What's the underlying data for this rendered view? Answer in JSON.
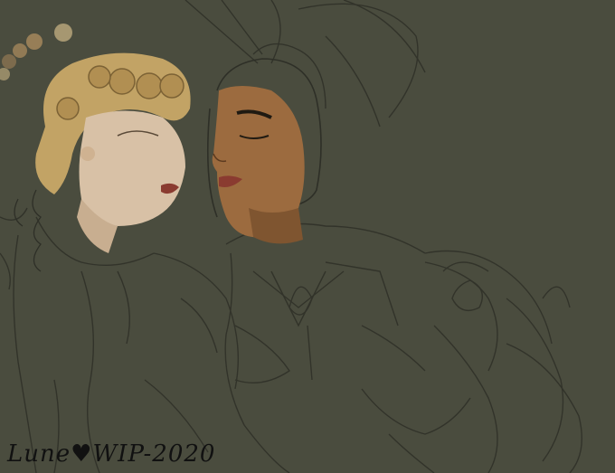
{
  "artwork": {
    "background_color": "#4a4c3e",
    "sketch_line_color": "#2e2f27",
    "left_hair_color": "#c2a365",
    "left_skin_color": "#d8c1a6",
    "right_skin_color": "#9c6b3f",
    "lips_color": "#8a3b30",
    "bokeh_colors": [
      "#f3d69a",
      "#d7a86c",
      "#b0895c"
    ]
  },
  "signature": {
    "text": "Lune♥WIP-2020"
  }
}
